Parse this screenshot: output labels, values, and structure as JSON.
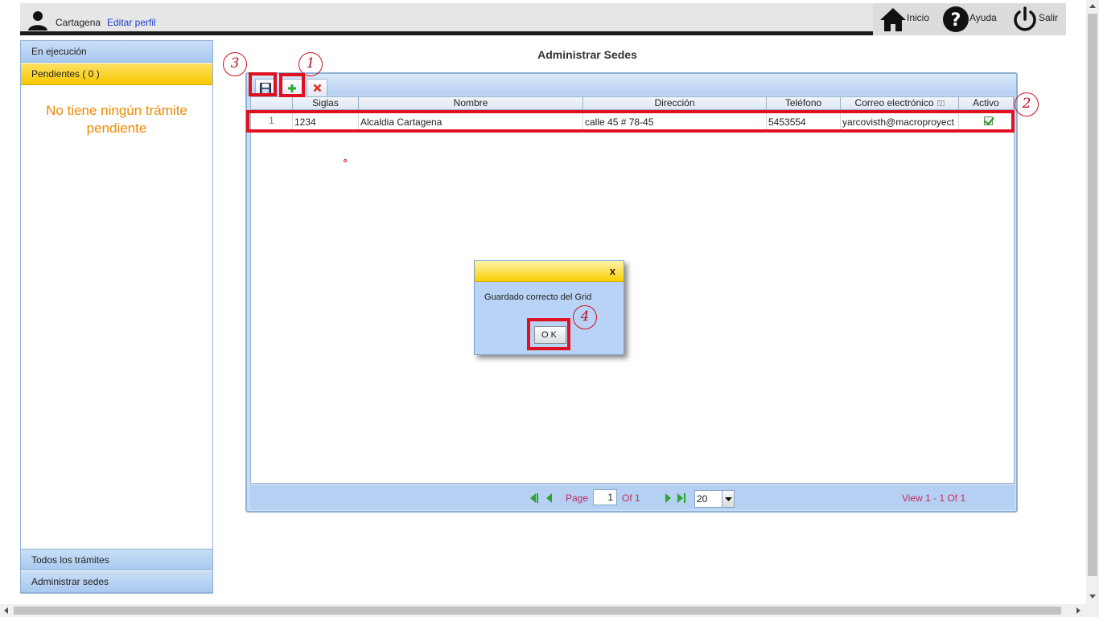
{
  "header": {
    "user_name": "Cartagena",
    "edit_profile": "Editar perfil",
    "nav": [
      {
        "label": "Inicio",
        "icon": "home-icon"
      },
      {
        "label": "Ayuda",
        "icon": "help-icon"
      },
      {
        "label": "Salir",
        "icon": "power-icon"
      }
    ]
  },
  "sidebar": {
    "tabs": [
      "En ejecución",
      "Pendientes ( 0 )"
    ],
    "empty_line1": "No tiene ningún trámite",
    "empty_line2": "pendiente",
    "bottom_tabs": [
      "Todos los trámites",
      "Administrar sedes"
    ]
  },
  "main": {
    "title": "Administrar Sedes",
    "grid": {
      "columns": [
        "",
        "Siglas",
        "Nombre",
        "Dirección",
        "Teléfono",
        "Correo electrónico",
        "Activo"
      ],
      "rows": [
        {
          "num": "1",
          "siglas": "1234",
          "nombre": "Alcaldia Cartagena",
          "direccion": "calle 45 # 78-45",
          "telefono": "5453554",
          "correo": "yarcovisth@macroproyect",
          "activo": true
        }
      ]
    },
    "pager": {
      "page_label": "Page",
      "page_value": "1",
      "of_label": "Of 1",
      "page_size": "20",
      "view_text": "View 1 - 1 Of 1"
    }
  },
  "dialog": {
    "close": "x",
    "message": "Guardado correcto del Grid",
    "ok_label": "OK"
  },
  "annotations": [
    "1",
    "2",
    "3",
    "4"
  ],
  "colors": {
    "accent_yellow": "#f7c700",
    "panel_blue": "#b8d3f5",
    "highlight_red": "#e01020",
    "empty_orange": "#f08a00"
  }
}
